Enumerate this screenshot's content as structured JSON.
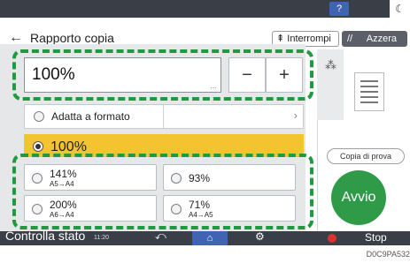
{
  "topbar": {
    "help_label": "?",
    "moon_label": "☾"
  },
  "header": {
    "back_label": "←",
    "title": "Rapporto copia",
    "interrompi_label": "Interrompi",
    "interrompi_icon": "interrupt-icon",
    "azzera_label": "Azzera",
    "azzera_icon": "reset-icon"
  },
  "ratio": {
    "value": "100%",
    "dots": "...",
    "minus_label": "−",
    "plus_label": "+"
  },
  "fit": {
    "label": "Adatta a formato",
    "chevron": "›"
  },
  "selected": {
    "label": "100%"
  },
  "presets": [
    {
      "main": "141%",
      "sub": "A5→A4"
    },
    {
      "main": "93%",
      "sub": ""
    },
    {
      "main": "200%",
      "sub": "A6→A4"
    },
    {
      "main": "71%",
      "sub": "A4→A5"
    }
  ],
  "right": {
    "proof_label": "Copia di prova",
    "start_label": "Avvio"
  },
  "bottombar": {
    "status_label": "Controlla stato",
    "time": "11:20",
    "return_icon": "⤺",
    "home_icon": "⌂",
    "settings_icon": "⚙",
    "stop_label": "Stop"
  },
  "caption": "D0C9PA532",
  "colors": {
    "accent_green": "#2f9b49",
    "highlight_green": "#1f9a3f",
    "selected_yellow": "#f3c330",
    "help_blue": "#3f64b4"
  }
}
